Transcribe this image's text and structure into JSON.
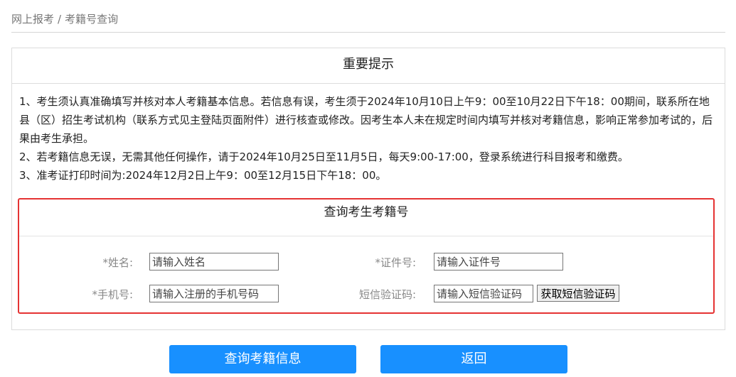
{
  "breadcrumb": {
    "items": [
      "网上报考",
      "考籍号查询"
    ],
    "separator": "/"
  },
  "notice": {
    "title": "重要提示",
    "paragraphs": [
      "1、考生须认真准确填写并核对本人考籍基本信息。若信息有误，考生须于2024年10月10日上午9：00至10月22日下午18：00期间，联系所在地县（区）招生考试机构（联系方式见主登陆页面附件）进行核查或修改。因考生本人未在规定时间内填写并核对考籍信息，影响正常参加考试的，后果由考生承担。",
      "2、若考籍信息无误，无需其他任何操作，请于2024年10月25日至11月5日，每天9:00-17:00，登录系统进行科目报考和缴费。",
      "3、准考证打印时间为:2024年12月2日上午9：00至12月15日下午18：00。"
    ]
  },
  "query": {
    "title": "查询考生考籍号",
    "name": {
      "label": "*姓名:",
      "placeholder": "请输入姓名",
      "value": ""
    },
    "id_number": {
      "label": "*证件号:",
      "placeholder": "请输入证件号",
      "value": ""
    },
    "phone": {
      "label": "*手机号:",
      "placeholder": "请输入注册的手机号码",
      "value": ""
    },
    "sms_code": {
      "label": "短信验证码:",
      "placeholder": "请输入短信验证码",
      "value": ""
    },
    "sms_button": "获取短信验证码"
  },
  "actions": {
    "query_button": "查询考籍信息",
    "back_button": "返回"
  },
  "colors": {
    "primary": "#1890ff",
    "highlight_border": "#e53333",
    "label": "#888888"
  }
}
